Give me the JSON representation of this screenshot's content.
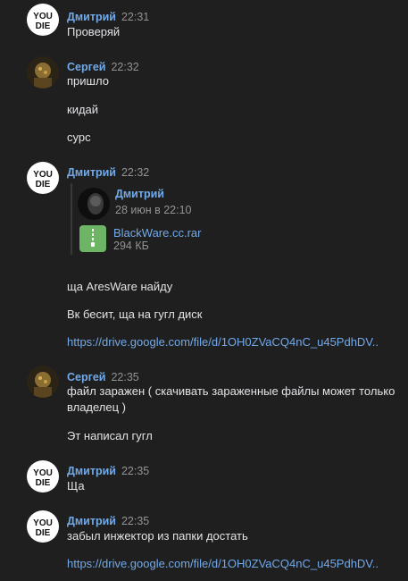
{
  "messages": [
    {
      "author": "Дмитрий",
      "time": "22:31",
      "lines": [
        "Проверяй"
      ]
    },
    {
      "author": "Сергей",
      "time": "22:32",
      "lines": [
        "пришло",
        "кидай",
        "сурс"
      ]
    },
    {
      "author": "Дмитрий",
      "time": "22:32",
      "forward": {
        "author": "Дмитрий",
        "date": "28 июн в 22:10",
        "doc": {
          "name": "BlackWare.cc.rar",
          "size": "294 КБ"
        }
      },
      "lines": [
        "ща AresWare найду",
        "Вк бесит, ща на гугл диск",
        "https://drive.google.com/file/d/1OH0ZVaCQ4nC_u45PdhDV.."
      ]
    },
    {
      "author": "Сергей",
      "time": "22:35",
      "lines": [
        "файл заражен ( скачивать зараженные файлы может только владелец )",
        "Эт написал гугл"
      ]
    },
    {
      "author": "Дмитрий",
      "time": "22:35",
      "lines": [
        "Ща"
      ]
    },
    {
      "author": "Дмитрий",
      "time": "22:35",
      "lines": [
        "забыл инжектор из папки достать",
        "https://drive.google.com/file/d/1OH0ZVaCQ4nC_u45PdhDV.."
      ]
    }
  ],
  "colors": {
    "background": "#1f1f1f",
    "author": "#71aaeb",
    "text": "#e1e3e6",
    "time": "#939393",
    "link": "#71aaeb",
    "doc_icon": "#6eb465"
  },
  "icons": {
    "dmitry_avatar": "you-die-logo-avatar",
    "sergey_avatar": "photo-avatar",
    "doc": "zip-archive-icon"
  }
}
